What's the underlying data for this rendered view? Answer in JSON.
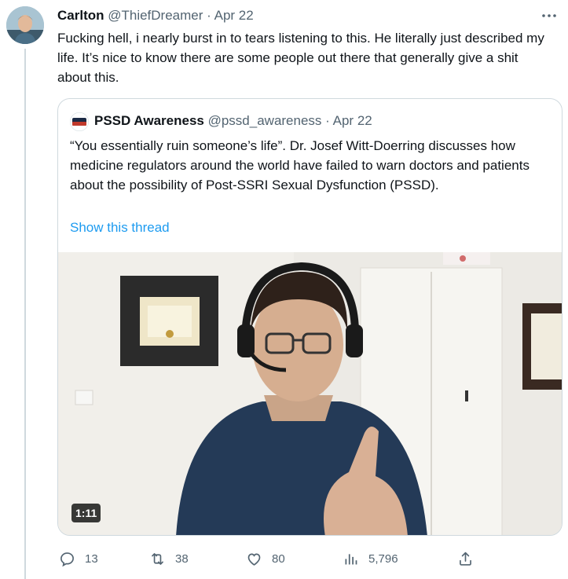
{
  "tweet": {
    "author_name": "Carlton",
    "author_handle": "@ThiefDreamer",
    "separator": "·",
    "date": "Apr 22",
    "text": "Fucking hell, i nearly burst in to tears listening to this. He literally just described my life. It’s nice to know there are some people out there that generally give a shit about this."
  },
  "quote": {
    "author_name": "PSSD Awareness",
    "author_handle": "@pssd_awareness",
    "separator": "·",
    "date": "Apr 22",
    "text": "“You essentially ruin someone’s life”.  Dr. Josef Witt-Doerring discusses how medicine regulators around the world have failed to warn doctors and patients about the possibility of Post-SSRI Sexual Dysfunction (PSSD).",
    "show_thread": "Show this thread",
    "video_duration": "1:11"
  },
  "actions": {
    "replies": "13",
    "retweets": "38",
    "likes": "80",
    "views": "5,796"
  },
  "colors": {
    "accent": "#1d9bf0",
    "muted": "#536471",
    "border": "#cfd9de"
  }
}
